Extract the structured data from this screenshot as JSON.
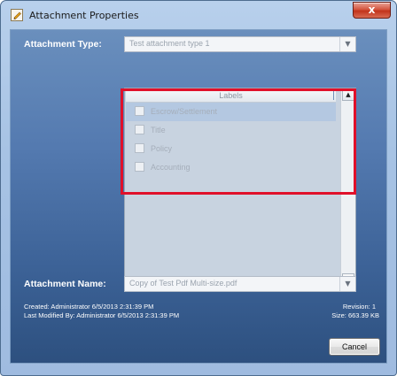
{
  "window": {
    "title": "Attachment Properties",
    "close_label": "x"
  },
  "attachment_type": {
    "label": "Attachment Type:",
    "value": "Test attachment type 1"
  },
  "labels_list": {
    "header": "Labels",
    "items": [
      {
        "label": "Escrow/Settlement",
        "checked": false,
        "selected": true
      },
      {
        "label": "Title",
        "checked": false,
        "selected": false
      },
      {
        "label": "Policy",
        "checked": false,
        "selected": false
      },
      {
        "label": "Accounting",
        "checked": false,
        "selected": false
      }
    ]
  },
  "attachment_name": {
    "label": "Attachment Name:",
    "value": "Copy of Test Pdf Multi-size.pdf"
  },
  "info": {
    "created": "Created: Administrator 6/5/2013 2:31:39 PM",
    "last_modified": "Last Modified By: Administrator 6/5/2013 2:31:39 PM",
    "revision": "Revision: 1",
    "size": "Size: 663.39 KB"
  },
  "buttons": {
    "cancel": "Cancel"
  },
  "colors": {
    "highlight_border": "#e0102a",
    "client_background": "#4a6fa5",
    "close_button": "#c7402b"
  },
  "icons": {
    "app": "edit-document-icon",
    "dropdown": "chevron-down-icon",
    "scroll_up": "scroll-up-arrow-icon",
    "scroll_down": "scroll-down-arrow-icon"
  }
}
